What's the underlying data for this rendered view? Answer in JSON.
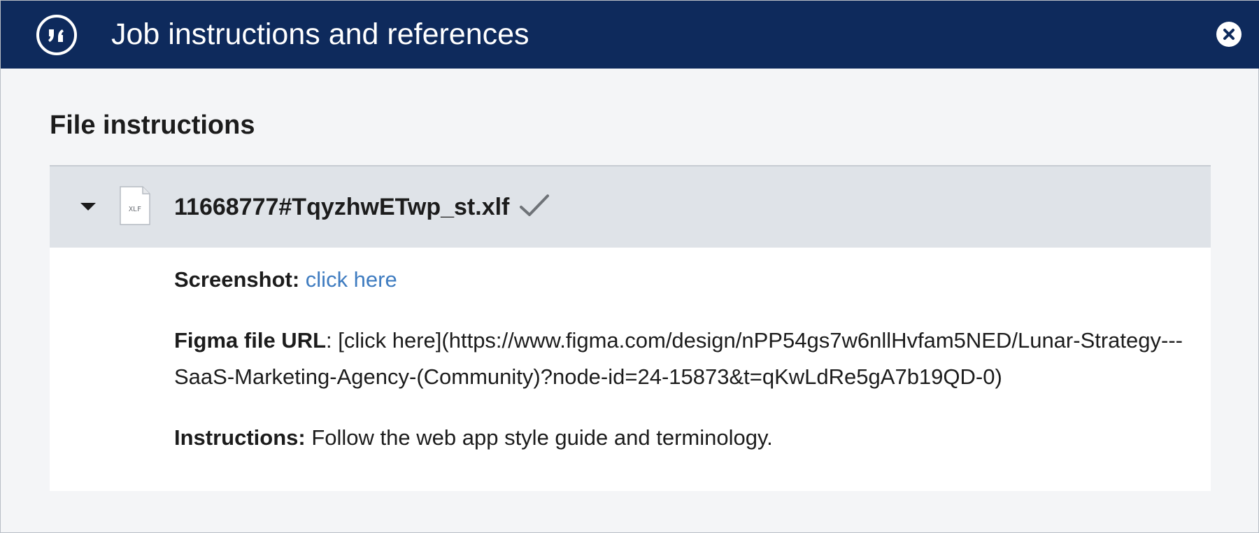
{
  "header": {
    "title": "Job instructions and references",
    "badge_icon": "quote-icon",
    "close_icon": "close-circle-icon"
  },
  "section": {
    "heading": "File instructions"
  },
  "file": {
    "name": "11668777#TqyzhwETwp_st.xlf",
    "type_label": "XLF",
    "status_icon": "checkmark-icon",
    "expanded": true
  },
  "fields": {
    "screenshot_label": "Screenshot:",
    "screenshot_link": "click here",
    "figma_label": "Figma file URL",
    "figma_value": ": [click here](https://www.figma.com/design/nPP54gs7w6nllHvfam5NED/Lunar-Strategy---SaaS-Marketing-Agency-(Community)?node-id=24-15873&t=qKwLdRe5gA7b19QD-0)",
    "instructions_label": "Instructions:",
    "instructions_value": " Follow the web app style guide and terminology."
  },
  "colors": {
    "header_bg": "#0e2a5c",
    "link": "#3f7cc0",
    "row_bg": "#dfe3e8",
    "page_bg": "#f4f5f7"
  }
}
